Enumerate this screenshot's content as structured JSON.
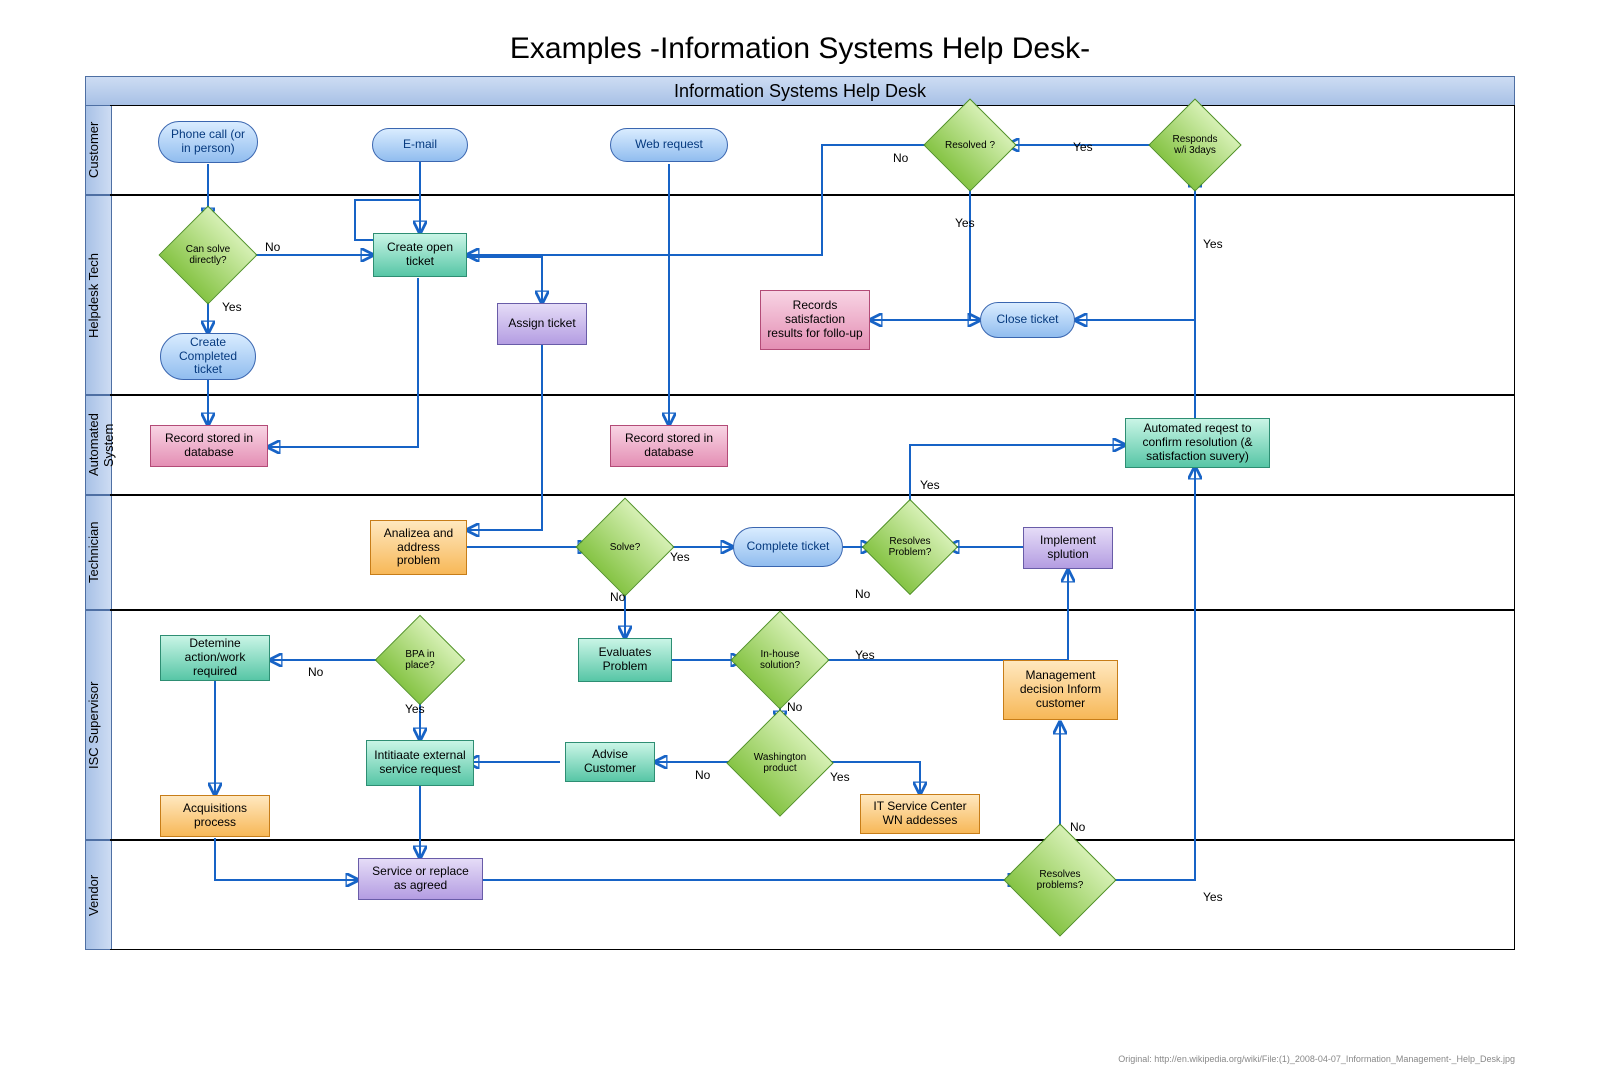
{
  "title": "Examples -Information Systems Help Desk-",
  "pool_title": "Information Systems Help Desk",
  "credit": "Original: http://en.wikipedia.org/wiki/File:(1)_2008-04-07_Information_Management-_Help_Desk.jpg",
  "lanes": {
    "customer": "Customer",
    "helpdesk": "Helpdesk Tech",
    "automated": "Automated System",
    "technician": "Technician",
    "supervisor": "ISC Supervisor",
    "vendor": "Vendor"
  },
  "nodes": {
    "phone": "Phone call (or in person)",
    "email": "E-mail",
    "web": "Web request",
    "resolved": "Resolved ?",
    "responds": "Responds w/i 3days",
    "can_solve": "Can solve directly?",
    "create_open": "Create open ticket",
    "assign": "Assign ticket",
    "create_completed": "Create Completed ticket",
    "close_ticket": "Close ticket",
    "records_sat": "Records satisfaction results for follo-up",
    "rec_db1": "Record stored in database",
    "rec_db2": "Record stored in database",
    "auto_req": "Automated reqest to confirm resolution (& satisfaction suvery)",
    "analyze": "Analizea and address problem",
    "solve": "Solve?",
    "complete": "Complete ticket",
    "resolves_prob": "Resolves Problem?",
    "implement": "Implement splution",
    "determine": "Detemine action/work required",
    "bpa": "BPA in place?",
    "evaluates": "Evaluates Problem",
    "inhouse": "In-house solution?",
    "initiate_ext": "Intitiaate external service request",
    "advise": "Advise Customer",
    "washington": "Washington product",
    "it_center": "IT Service Center WN addesses",
    "mgmt": "Management decision Inform customer",
    "acquisitions": "Acquisitions process",
    "service_replace": "Service or replace as agreed",
    "resolves_problems": "Resolves problems?"
  },
  "labels": {
    "yes": "Yes",
    "no": "No"
  },
  "chart_data": {
    "type": "swimlane_flowchart",
    "pool": "Information Systems Help Desk",
    "lanes": [
      "Customer",
      "Helpdesk Tech",
      "Automated System",
      "Technician",
      "ISC Supervisor",
      "Vendor"
    ],
    "shapes": {
      "terminator": [
        "phone",
        "email",
        "web",
        "create_completed",
        "close_ticket",
        "complete"
      ],
      "decision": [
        "resolved",
        "responds",
        "can_solve",
        "solve",
        "resolves_prob",
        "bpa",
        "inhouse",
        "washington",
        "resolves_problems"
      ],
      "process": [
        "create_open",
        "assign",
        "records_sat",
        "rec_db1",
        "rec_db2",
        "auto_req",
        "analyze",
        "implement",
        "determine",
        "evaluates",
        "initiate_ext",
        "advise",
        "it_center",
        "mgmt",
        "acquisitions",
        "service_replace"
      ]
    },
    "nodes": [
      {
        "id": "phone",
        "lane": "Customer",
        "label": "Phone call (or in person)"
      },
      {
        "id": "email",
        "lane": "Customer",
        "label": "E-mail"
      },
      {
        "id": "web",
        "lane": "Customer",
        "label": "Web request"
      },
      {
        "id": "resolved",
        "lane": "Customer",
        "label": "Resolved ?"
      },
      {
        "id": "responds",
        "lane": "Customer",
        "label": "Responds w/i 3days"
      },
      {
        "id": "can_solve",
        "lane": "Helpdesk Tech",
        "label": "Can solve directly?"
      },
      {
        "id": "create_open",
        "lane": "Helpdesk Tech",
        "label": "Create open ticket"
      },
      {
        "id": "assign",
        "lane": "Helpdesk Tech",
        "label": "Assign ticket"
      },
      {
        "id": "create_completed",
        "lane": "Helpdesk Tech",
        "label": "Create Completed ticket"
      },
      {
        "id": "close_ticket",
        "lane": "Helpdesk Tech",
        "label": "Close ticket"
      },
      {
        "id": "records_sat",
        "lane": "Helpdesk Tech",
        "label": "Records satisfaction results for follo-up"
      },
      {
        "id": "rec_db1",
        "lane": "Automated System",
        "label": "Record stored in database"
      },
      {
        "id": "rec_db2",
        "lane": "Automated System",
        "label": "Record stored in database"
      },
      {
        "id": "auto_req",
        "lane": "Automated System",
        "label": "Automated reqest to confirm resolution (& satisfaction suvery)"
      },
      {
        "id": "analyze",
        "lane": "Technician",
        "label": "Analizea and address problem"
      },
      {
        "id": "solve",
        "lane": "Technician",
        "label": "Solve?"
      },
      {
        "id": "complete",
        "lane": "Technician",
        "label": "Complete ticket"
      },
      {
        "id": "resolves_prob",
        "lane": "Technician",
        "label": "Resolves Problem?"
      },
      {
        "id": "implement",
        "lane": "Technician",
        "label": "Implement splution"
      },
      {
        "id": "determine",
        "lane": "ISC Supervisor",
        "label": "Detemine action/work required"
      },
      {
        "id": "bpa",
        "lane": "ISC Supervisor",
        "label": "BPA in place?"
      },
      {
        "id": "evaluates",
        "lane": "ISC Supervisor",
        "label": "Evaluates Problem"
      },
      {
        "id": "inhouse",
        "lane": "ISC Supervisor",
        "label": "In-house solution?"
      },
      {
        "id": "initiate_ext",
        "lane": "ISC Supervisor",
        "label": "Intitiaate external service request"
      },
      {
        "id": "advise",
        "lane": "ISC Supervisor",
        "label": "Advise Customer"
      },
      {
        "id": "washington",
        "lane": "ISC Supervisor",
        "label": "Washington product"
      },
      {
        "id": "it_center",
        "lane": "ISC Supervisor",
        "label": "IT Service Center WN addesses"
      },
      {
        "id": "mgmt",
        "lane": "ISC Supervisor",
        "label": "Management decision Inform customer"
      },
      {
        "id": "acquisitions",
        "lane": "Vendor",
        "label": "Acquisitions process"
      },
      {
        "id": "service_replace",
        "lane": "Vendor",
        "label": "Service or replace as agreed"
      },
      {
        "id": "resolves_problems",
        "lane": "Vendor",
        "label": "Resolves problems?"
      }
    ],
    "edges": [
      {
        "from": "phone",
        "to": "can_solve"
      },
      {
        "from": "email",
        "to": "create_open"
      },
      {
        "from": "web",
        "to": "rec_db2"
      },
      {
        "from": "can_solve",
        "to": "create_open",
        "label": "No"
      },
      {
        "from": "can_solve",
        "to": "create_completed",
        "label": "Yes"
      },
      {
        "from": "create_completed",
        "to": "rec_db1"
      },
      {
        "from": "create_open",
        "to": "rec_db1"
      },
      {
        "from": "create_open",
        "to": "assign"
      },
      {
        "from": "assign",
        "to": "analyze"
      },
      {
        "from": "rec_db2",
        "to": "analyze"
      },
      {
        "from": "analyze",
        "to": "solve"
      },
      {
        "from": "solve",
        "to": "complete",
        "label": "Yes"
      },
      {
        "from": "solve",
        "to": "evaluates",
        "label": "No"
      },
      {
        "from": "complete",
        "to": "auto_req"
      },
      {
        "from": "auto_req",
        "to": "responds"
      },
      {
        "from": "responds",
        "to": "resolved",
        "label": "Yes"
      },
      {
        "from": "responds",
        "to": "close_ticket",
        "label": "Yes"
      },
      {
        "from": "resolved",
        "to": "close_ticket",
        "label": "Yes"
      },
      {
        "from": "resolved",
        "to": "create_open",
        "label": "No"
      },
      {
        "from": "close_ticket",
        "to": "records_sat"
      },
      {
        "from": "evaluates",
        "to": "inhouse"
      },
      {
        "from": "inhouse",
        "to": "implement",
        "label": "Yes"
      },
      {
        "from": "inhouse",
        "to": "washington",
        "label": "No"
      },
      {
        "from": "implement",
        "to": "resolves_prob"
      },
      {
        "from": "resolves_prob",
        "to": "auto_req",
        "label": "Yes"
      },
      {
        "from": "resolves_prob",
        "to": "evaluates",
        "label": "No"
      },
      {
        "from": "washington",
        "to": "it_center",
        "label": "Yes"
      },
      {
        "from": "washington",
        "to": "advise",
        "label": "No"
      },
      {
        "from": "advise",
        "to": "initiate_ext"
      },
      {
        "from": "bpa",
        "to": "initiate_ext",
        "label": "Yes"
      },
      {
        "from": "bpa",
        "to": "determine",
        "label": "No"
      },
      {
        "from": "determine",
        "to": "acquisitions"
      },
      {
        "from": "acquisitions",
        "to": "service_replace"
      },
      {
        "from": "initiate_ext",
        "to": "service_replace"
      },
      {
        "from": "service_replace",
        "to": "resolves_problems"
      },
      {
        "from": "it_center",
        "to": "resolves_problems"
      },
      {
        "from": "resolves_problems",
        "to": "auto_req",
        "label": "Yes"
      },
      {
        "from": "resolves_problems",
        "to": "mgmt",
        "label": "No"
      }
    ]
  }
}
